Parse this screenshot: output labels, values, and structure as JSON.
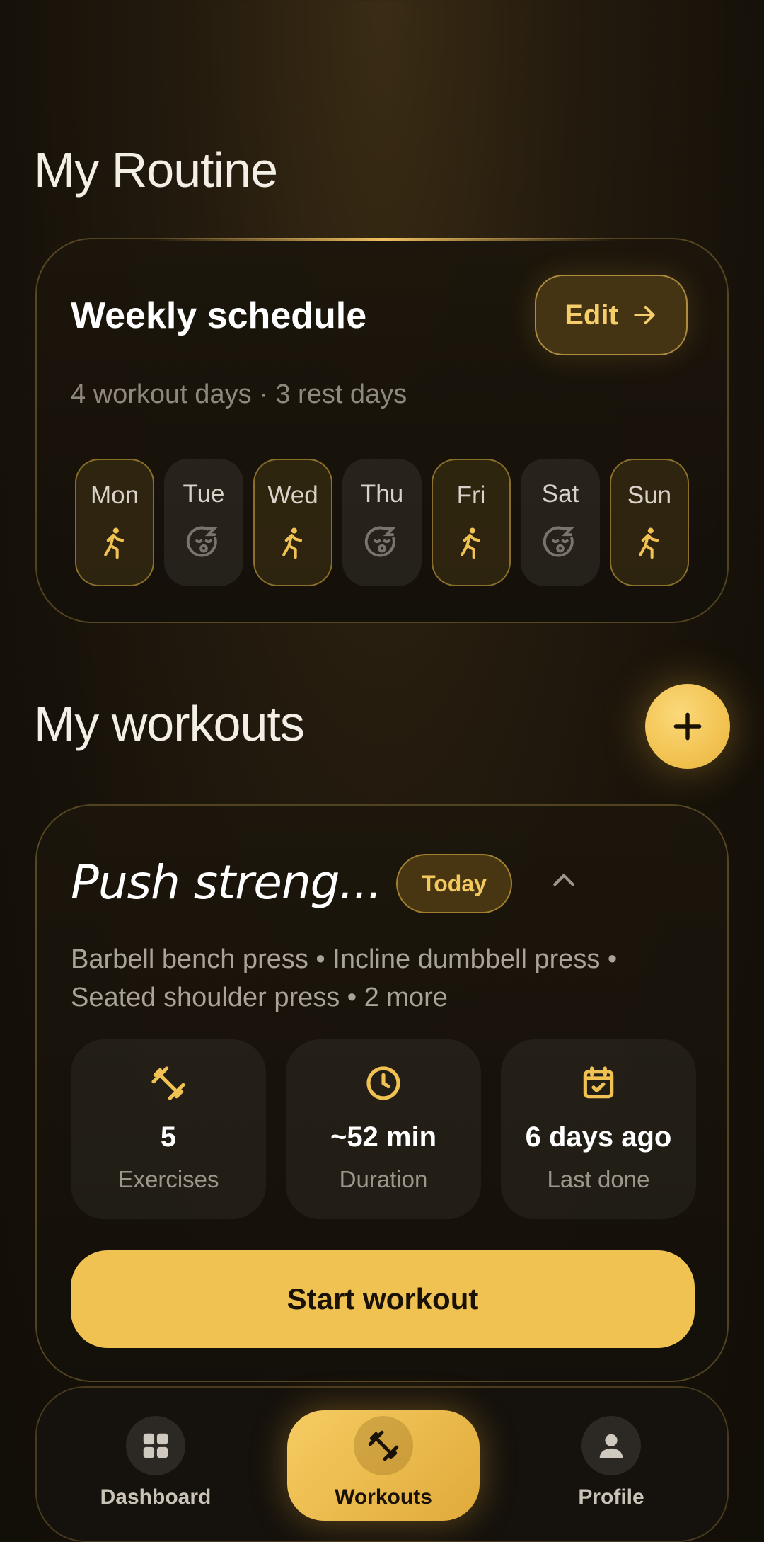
{
  "routine": {
    "title": "My Routine",
    "schedule_title": "Weekly schedule",
    "edit_label": "Edit",
    "summary": "4 workout days · 3 rest days",
    "days": [
      {
        "label": "Mon",
        "type": "workout"
      },
      {
        "label": "Tue",
        "type": "rest"
      },
      {
        "label": "Wed",
        "type": "workout"
      },
      {
        "label": "Thu",
        "type": "rest"
      },
      {
        "label": "Fri",
        "type": "workout"
      },
      {
        "label": "Sat",
        "type": "rest"
      },
      {
        "label": "Sun",
        "type": "workout"
      }
    ]
  },
  "workouts": {
    "title": "My workouts",
    "add_icon": "plus-icon",
    "card": {
      "name": "Push streng...",
      "badge": "Today",
      "exercises_text": "Barbell bench press • Incline dumbbell press • Seated shoulder press • 2 more",
      "stats": [
        {
          "icon": "dumbbell-icon",
          "value": "5",
          "label": "Exercises"
        },
        {
          "icon": "clock-icon",
          "value": "~52 min",
          "label": "Duration"
        },
        {
          "icon": "calendar-check-icon",
          "value": "6 days ago",
          "label": "Last done"
        }
      ],
      "start_label": "Start workout"
    }
  },
  "nav": {
    "items": [
      {
        "label": "Dashboard",
        "icon": "grid-icon"
      },
      {
        "label": "Workouts",
        "icon": "dumbbell-icon",
        "active": true
      },
      {
        "label": "Profile",
        "icon": "person-icon"
      }
    ]
  },
  "colors": {
    "accent": "#f0c252",
    "background": "#1a140b",
    "muted_text": "#8e887e"
  }
}
